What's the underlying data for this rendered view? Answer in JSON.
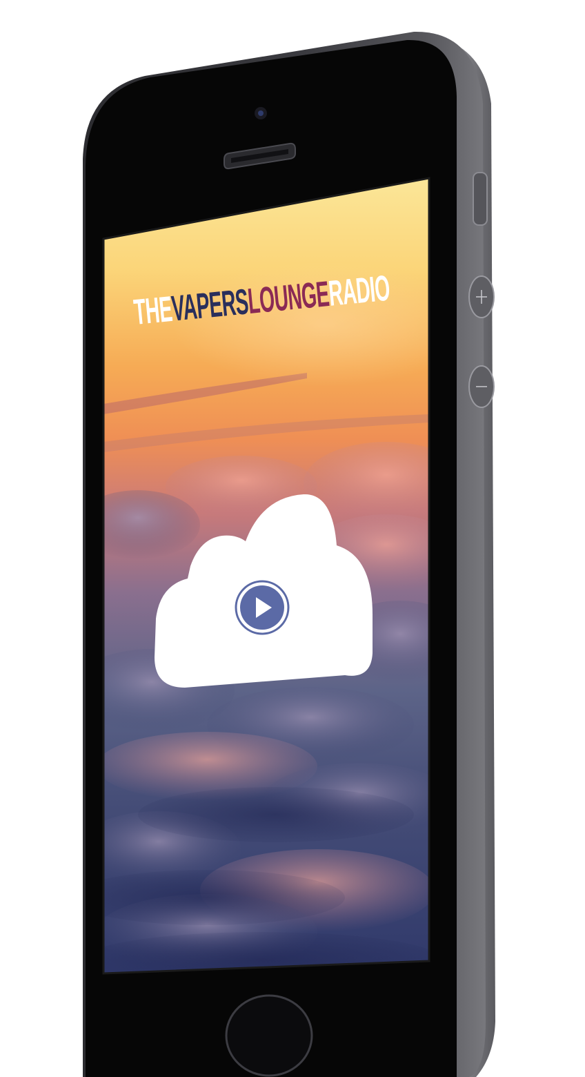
{
  "device": {
    "model": "smartphone",
    "icons": {
      "camera": "front-camera-icon",
      "speaker": "earpiece-speaker-icon",
      "home": "home-button-icon",
      "mute": "mute-switch-icon",
      "volume_up": "volume-up-icon",
      "volume_down": "volume-down-icon"
    },
    "colors": {
      "body": "#3f3f43",
      "bezel": "#050505",
      "frame_edge": "#6c6c70"
    }
  },
  "app": {
    "logo": {
      "part_the": "THE",
      "part_vapers": "VAPERS",
      "part_lounge": "LOUNGE",
      "part_radio": "RADIO"
    },
    "colors": {
      "the": "#ffffff",
      "vapers": "#2a2f5c",
      "lounge": "#8a2a55",
      "radio": "#ffffff",
      "play_button": "#5b6aa6",
      "cloud": "#ffffff"
    },
    "icons": {
      "cloud": "cloud-icon",
      "play": "play-icon"
    }
  }
}
